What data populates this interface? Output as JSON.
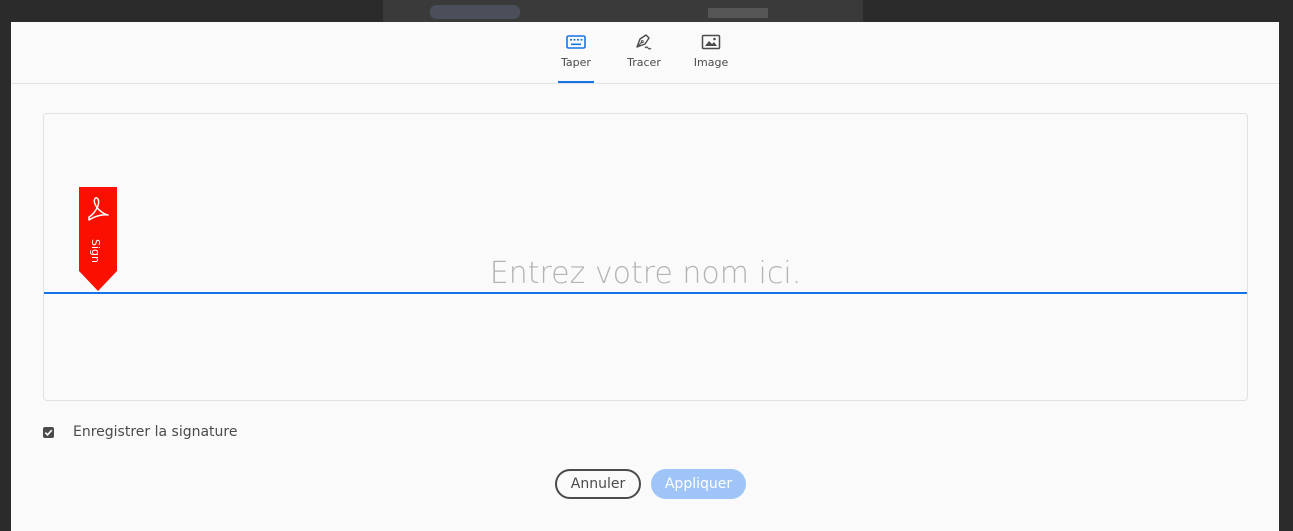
{
  "tabs": [
    {
      "label": "Taper",
      "icon": "keyboard-icon",
      "active": true
    },
    {
      "label": "Tracer",
      "icon": "pen-draw-icon",
      "active": false
    },
    {
      "label": "Image",
      "icon": "image-icon",
      "active": false
    }
  ],
  "badge": {
    "label": "Sign",
    "icon": "acrobat-logo-icon",
    "color": "#fa0f00"
  },
  "signature_input": {
    "placeholder": "Entrez votre nom ici.",
    "value": ""
  },
  "save_option": {
    "label": "Enregistrer la signature",
    "checked": true
  },
  "buttons": {
    "cancel": "Annuler",
    "apply": "Appliquer"
  },
  "colors": {
    "accent": "#1473e6",
    "apply_disabled": "#9fc5f8",
    "badge": "#fa0f00"
  }
}
